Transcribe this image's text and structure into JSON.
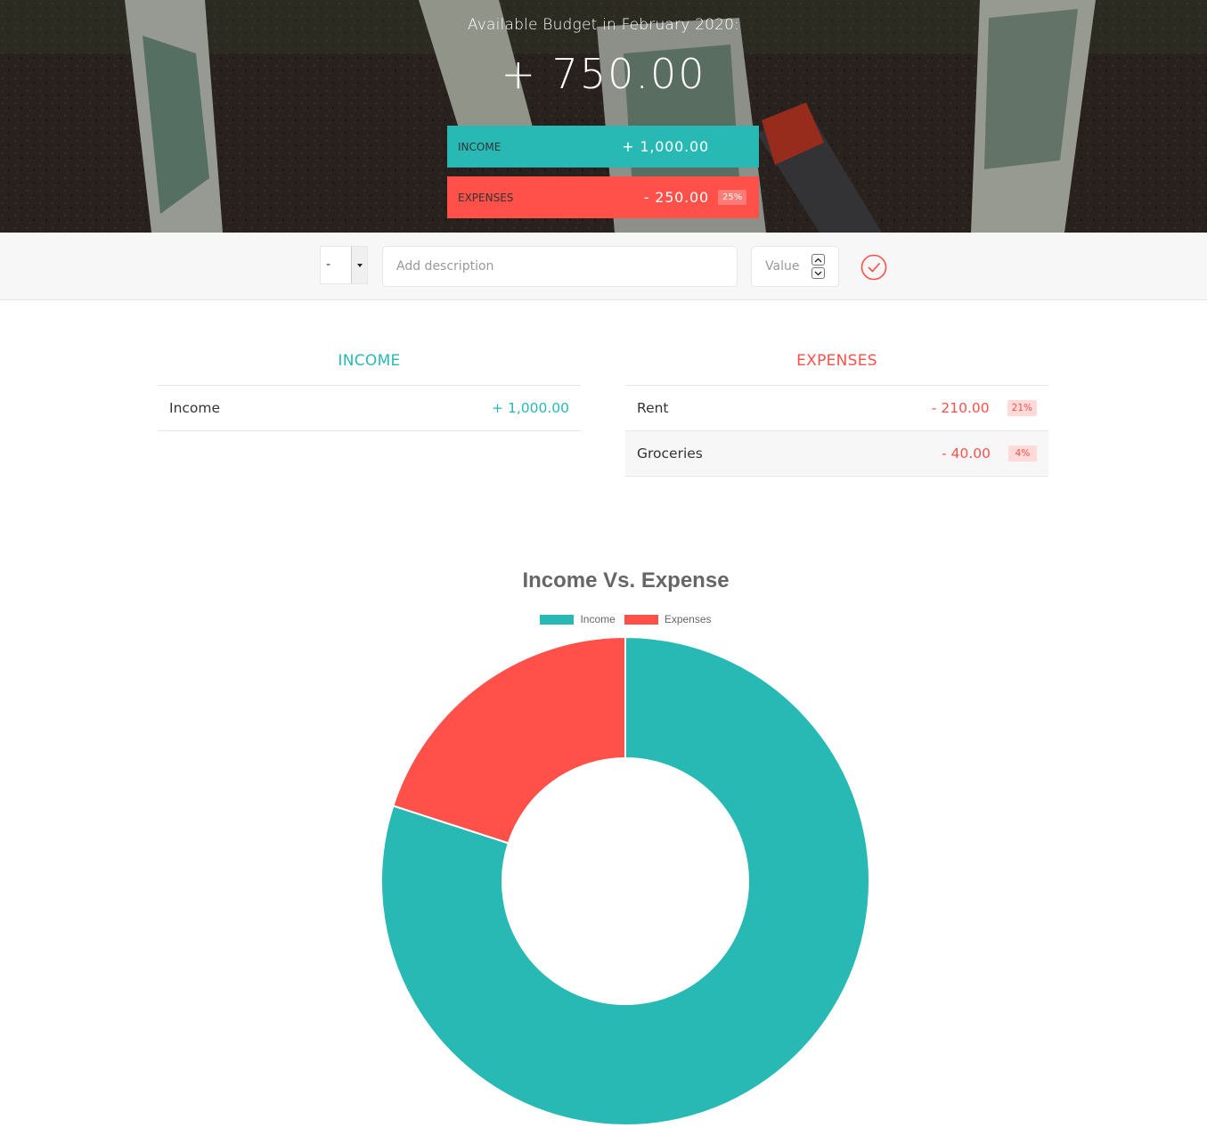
{
  "header": {
    "title": "Available Budget in February 2020:",
    "budget": "+ 750.00",
    "income_label": "Income",
    "income_value": "+ 1,000.00",
    "expenses_label": "Expenses",
    "expenses_value": "- 250.00",
    "expenses_percentage": "25%"
  },
  "add_form": {
    "type_value": "-",
    "description_placeholder": "Add description",
    "value_placeholder": "Value"
  },
  "income_list": {
    "title": "Income",
    "items": [
      {
        "description": "Income",
        "value": "+ 1,000.00"
      }
    ]
  },
  "expenses_list": {
    "title": "Expenses",
    "items": [
      {
        "description": "Rent",
        "value": "- 210.00",
        "percentage": "21%"
      },
      {
        "description": "Groceries",
        "value": "- 40.00",
        "percentage": "4%"
      }
    ]
  },
  "colors": {
    "income": "#28b9b5",
    "expenses": "#ff5049"
  },
  "icons": {
    "add": "checkmark-circle-icon",
    "spinner_up": "chevron-up-icon",
    "spinner_down": "chevron-down-icon",
    "select": "caret-down-icon"
  },
  "chart_data": {
    "type": "pie",
    "title": "Income Vs. Expense",
    "donut": true,
    "legend_position": "top",
    "categories": [
      "Income",
      "Expenses"
    ],
    "values": [
      1000,
      250
    ],
    "colors": [
      "#28b9b5",
      "#ff5049"
    ]
  }
}
